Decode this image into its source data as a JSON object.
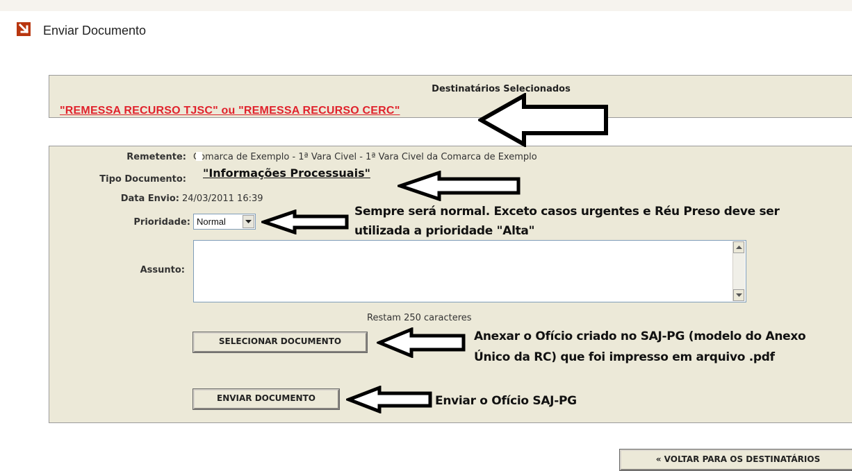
{
  "page": {
    "title": "Enviar Documento"
  },
  "destinatarios": {
    "header": "Destinatários Selecionados",
    "value": "\"REMESSA RECURSO   TJSC\"   ou   \"REMESSA RECURSO CERC\""
  },
  "form": {
    "remetente_label": "Remetente:",
    "remetente_value": "Comarca de Exemplo - 1ª Vara Civel - 1ª Vara Civel da Comarca de Exemplo",
    "tipo_label": "Tipo Documento:",
    "tipo_value": "\"Informações Processuais\"",
    "data_label": "Data Envio:",
    "data_value": "24/03/2011 16:39",
    "prioridade_label": "Prioridade:",
    "prioridade_value": "Normal",
    "assunto_label": "Assunto:",
    "assunto_value": "",
    "counter": "Restam 250 caracteres",
    "select_button": "SELECIONAR DOCUMENTO",
    "send_button": "ENVIAR DOCUMENTO"
  },
  "back_button": "« VOLTAR PARA OS DESTINATÁRIOS",
  "annotations": {
    "prioridade_line1": "Sempre será normal. Exceto casos urgentes e Réu Preso deve ser",
    "prioridade_line2": "utilizada a prioridade \"Alta\"",
    "anexar_line1": "Anexar o Ofício criado no SAJ-PG (modelo do Anexo",
    "anexar_line2": "Único da RC) que foi impresso em arquivo .pdf",
    "enviar": "Enviar o Ofício SAJ-PG"
  },
  "icons": [
    "title-arrow-icon",
    "dropdown-chevron-icon",
    "scroll-up-icon",
    "scroll-down-icon",
    "callout-arrow-icon"
  ],
  "colors": {
    "accent": "#b8360f",
    "highlight_red": "#e0222c",
    "panel": "#ece9d8"
  }
}
